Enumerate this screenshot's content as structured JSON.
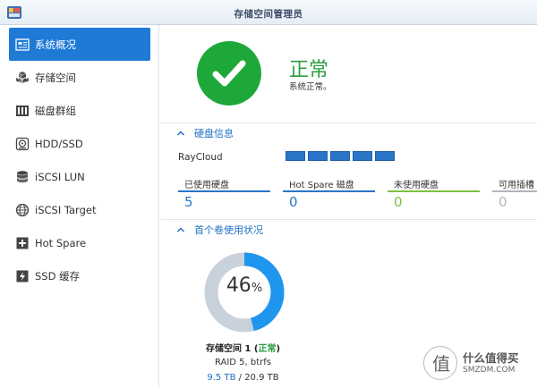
{
  "window": {
    "title": "存储空间管理员",
    "app_icon": "storage-manager-icon"
  },
  "sidebar": {
    "items": [
      {
        "label": "系统概况",
        "icon": "overview-icon",
        "active": true
      },
      {
        "label": "存储空间",
        "icon": "cubes-icon",
        "active": false
      },
      {
        "label": "磁盘群组",
        "icon": "disk-group-icon",
        "active": false
      },
      {
        "label": "HDD/SSD",
        "icon": "hdd-icon",
        "active": false
      },
      {
        "label": "iSCSI LUN",
        "icon": "database-icon",
        "active": false
      },
      {
        "label": "iSCSI Target",
        "icon": "globe-icon",
        "active": false
      },
      {
        "label": "Hot Spare",
        "icon": "plus-icon",
        "active": false
      },
      {
        "label": "SSD 缓存",
        "icon": "ssd-cache-icon",
        "active": false
      }
    ]
  },
  "status": {
    "title": "正常",
    "subtitle": "系统正常。",
    "icon": "check-icon",
    "color": "#1fa83a"
  },
  "disk_info": {
    "section_title": "硬盘信息",
    "device_name": "RayCloud",
    "slot_count": 5,
    "slot_color": "#2a75c8",
    "stats": [
      {
        "label": "已使用硬盘",
        "value": "5",
        "color": "#2a75c8"
      },
      {
        "label": "Hot Spare 磁盘",
        "value": "0",
        "color": "#2a75c8"
      },
      {
        "label": "未使用硬盘",
        "value": "0",
        "color": "#7cc242"
      },
      {
        "label": "可用插槽",
        "value": "0",
        "color": "#b0b6bd"
      }
    ]
  },
  "volume": {
    "section_title": "首个卷使用状况",
    "percent_number": "46",
    "percent_sign": "%",
    "used_fraction": 0.46,
    "name": "存储空间 1",
    "status": "正常",
    "raid": "RAID 5, btrfs",
    "used": "9.5 TB",
    "total": "20.9 TB",
    "used_color": "#1e96ee",
    "free_color": "#c9d1da"
  },
  "watermark": {
    "text": "什么值得买",
    "sub": "SMZDM.COM"
  }
}
